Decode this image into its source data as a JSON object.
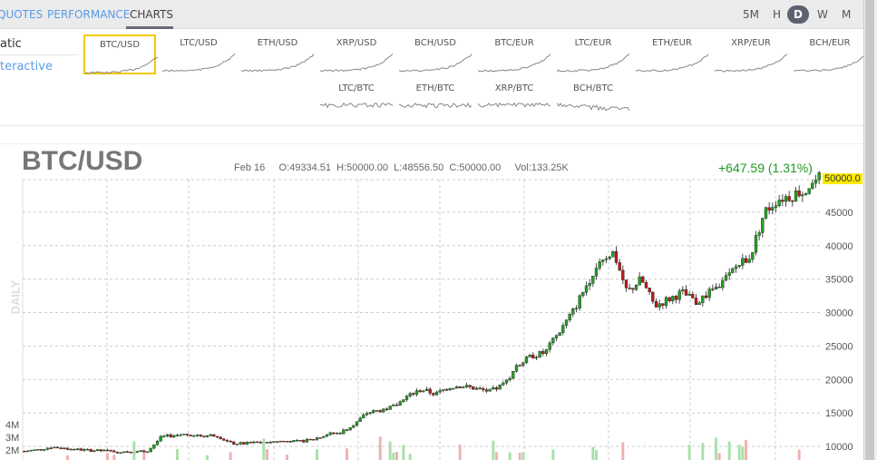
{
  "tabs": [
    {
      "label": "QUOTES"
    },
    {
      "label": "PERFORMANCE"
    },
    {
      "label": "CHARTS",
      "active": true
    }
  ],
  "periods": [
    "5M",
    "H",
    "D",
    "W",
    "M"
  ],
  "selected_period": "D",
  "left_options": [
    "atic",
    "teractive"
  ],
  "pairs": [
    "BTC/USD",
    "LTC/USD",
    "ETH/USD",
    "XRP/USD",
    "BCH/USD",
    "BTC/EUR",
    "LTC/EUR",
    "ETH/EUR",
    "XRP/EUR",
    "BCH/EUR",
    "LTC/BTC",
    "ETH/BTC",
    "XRP/BTC",
    "BCH/BTC"
  ],
  "selected_pair": "BTC/USD",
  "header": {
    "title": "BTC/USD",
    "date": "Feb 16",
    "open": "O:49334.51",
    "high": "H:50000.00",
    "low": "L:48556.50",
    "close": "C:50000.00",
    "volume": "Vol:133.25K",
    "change": "+647.59 (1.31%)",
    "last_price": "50000.0",
    "period_label": "DAILY"
  },
  "colors": {
    "up": "#22a022",
    "down": "#c01818",
    "accent": "#5a9be8",
    "highlight": "#ffeb00"
  },
  "chart_data": {
    "type": "candlestick",
    "title": "BTC/USD",
    "y_ticks": [
      45000,
      40000,
      35000,
      30000,
      25000,
      20000,
      15000,
      10000
    ],
    "y_tick_labels": [
      "45000",
      "40000",
      "35000",
      "30000",
      "25000",
      "20000",
      "15000",
      "10000"
    ],
    "volume_ticks": [
      "4M",
      "3M",
      "2M"
    ],
    "ylim": [
      8000,
      50500
    ],
    "approx_close_path": [
      9300,
      9500,
      9900,
      9700,
      9500,
      9400,
      9300,
      9200,
      9250,
      9300,
      11400,
      11700,
      11800,
      11600,
      11700,
      10500,
      10400,
      10600,
      10700,
      10800,
      10700,
      11000,
      11800,
      12000,
      13200,
      15000,
      15400,
      16000,
      17500,
      18500,
      17800,
      18900,
      19000,
      18600,
      18200,
      19300,
      22000,
      23500,
      24000,
      27000,
      30000,
      34000,
      38000,
      39000,
      33000,
      35000,
      31000,
      32000,
      33000,
      31500,
      33000,
      34500,
      37000,
      38500,
      45000,
      47000,
      47500,
      48500,
      50000
    ],
    "grid": "dashed"
  }
}
